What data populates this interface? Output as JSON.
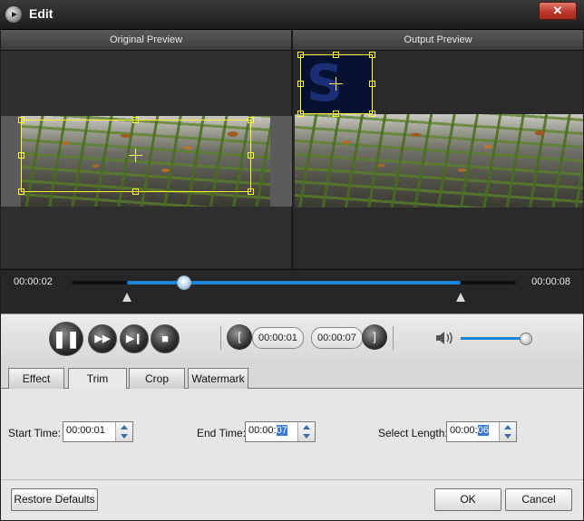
{
  "window": {
    "title": "Edit",
    "close_label": "✕"
  },
  "preview": {
    "original_label": "Original Preview",
    "output_label": "Output Preview"
  },
  "timeline": {
    "current_time": "00:00:02",
    "total_time": "00:00:08",
    "playhead_fraction": 0.25,
    "selection_start_fraction": 0.125,
    "selection_end_fraction": 0.875
  },
  "controls": {
    "pause_icon": "pause-icon",
    "fast_forward_icon": "fast-forward-icon",
    "next_frame_icon": "next-frame-icon",
    "stop_icon": "stop-icon",
    "trim_start": "00:00:01",
    "trim_end": "00:00:07",
    "volume_fraction": 0.95
  },
  "tabs": [
    {
      "label": "Effect",
      "active": false
    },
    {
      "label": "Trim",
      "active": true
    },
    {
      "label": "Crop",
      "active": false
    },
    {
      "label": "Watermark",
      "active": false
    }
  ],
  "trim": {
    "start_label": "Start Time:",
    "start_prefix": "00:00:01",
    "end_label": "End Time:",
    "end_prefix": "00:00:",
    "end_selected": "07",
    "length_label": "Select Length:",
    "length_prefix": "00:00:",
    "length_selected": "06"
  },
  "footer": {
    "restore_label": "Restore Defaults",
    "ok_label": "OK",
    "cancel_label": "Cancel"
  },
  "colors": {
    "accent": "#1b84d6",
    "crop_box": "#ffff33",
    "close_button": "#c0392b"
  }
}
